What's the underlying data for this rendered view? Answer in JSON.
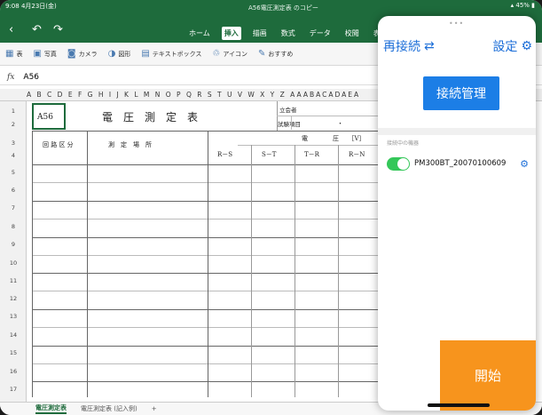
{
  "status": {
    "time_date": "9:08  4月23日(金)",
    "battery": "45%"
  },
  "title": {
    "document": "A56電圧測定表 のコピー"
  },
  "ribbon": {
    "tabs": [
      "ホーム",
      "挿入",
      "描画",
      "数式",
      "データ",
      "校閲",
      "表示"
    ],
    "active_index": 1
  },
  "toolbar": {
    "items": [
      {
        "label": "表",
        "icon": "table-icon"
      },
      {
        "label": "写真",
        "icon": "photo-icon"
      },
      {
        "label": "カメラ",
        "icon": "camera-icon"
      },
      {
        "label": "図形",
        "icon": "shapes-icon"
      },
      {
        "label": "テキストボックス",
        "icon": "textbox-icon"
      },
      {
        "label": "アイコン",
        "icon": "icons-icon"
      },
      {
        "label": "おすすめ",
        "icon": "recommend-icon"
      }
    ]
  },
  "formula_bar": {
    "fx": "fx",
    "cell_ref": "A56"
  },
  "columns": "A B C D E F G H I J K L M N O P Q R S T U V W X Y Z AAABACADAEA",
  "rows": [
    "1",
    "2",
    "3",
    "4",
    "5",
    "6",
    "7",
    "8",
    "9",
    "10",
    "11",
    "12",
    "13",
    "14",
    "15",
    "16",
    "17"
  ],
  "sheet": {
    "a56": "A56",
    "title": "電　圧　測　定　表",
    "witness": "立会者",
    "tester": "試験項目",
    "dot": "・",
    "circuit_header": "回 路 区 分",
    "location_header": "測　定　場　所",
    "voltage_header": "電　　　　圧　　［V］",
    "phases": [
      "R－S",
      "S－T",
      "T－R",
      "R－N"
    ]
  },
  "sheet_tabs": [
    "電圧測定表",
    "電圧測定表 (記入例)",
    "+"
  ],
  "panel": {
    "reconnect": "再接続",
    "settings": "設定",
    "connection_mgmt": "接続管理",
    "section": "接続中の機器",
    "device": "PM300BT_20070100609",
    "start": "開始"
  },
  "colors": {
    "excel_green": "#1e6b3c",
    "accent_blue": "#1c7ee6",
    "start_orange": "#f7941d",
    "toggle_green": "#34c759"
  }
}
